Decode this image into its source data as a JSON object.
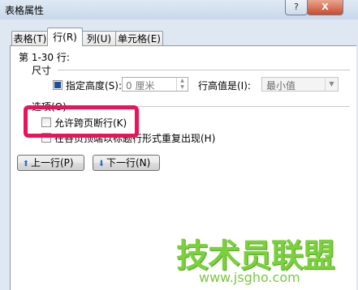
{
  "window": {
    "title": "表格属性",
    "help_label": "?",
    "close_label": "X"
  },
  "tabs": [
    {
      "label": "表格(T)"
    },
    {
      "label": "行(R)"
    },
    {
      "label": "列(U)"
    },
    {
      "label": "单元格(E)"
    }
  ],
  "row_panel": {
    "rows_label": "第 1-30 行:",
    "size_group": "尺寸",
    "specify_height_label": "指定高度(S):",
    "specify_height_checked": true,
    "height_value": "0 厘米",
    "row_height_is_label": "行高值是(I):",
    "row_height_is_value": "最小值",
    "options_group": "选项(O)",
    "allow_break_label": "允许跨页断行(K)",
    "allow_break_checked": false,
    "repeat_header_label": "在各页顶端以标题行形式重复出现(H)",
    "repeat_header_checked": false,
    "prev_row_label": "上一行(P)",
    "next_row_label": "下一行(N)"
  },
  "watermark": {
    "main": "技术员联盟",
    "url": "www.jsgho.com"
  }
}
